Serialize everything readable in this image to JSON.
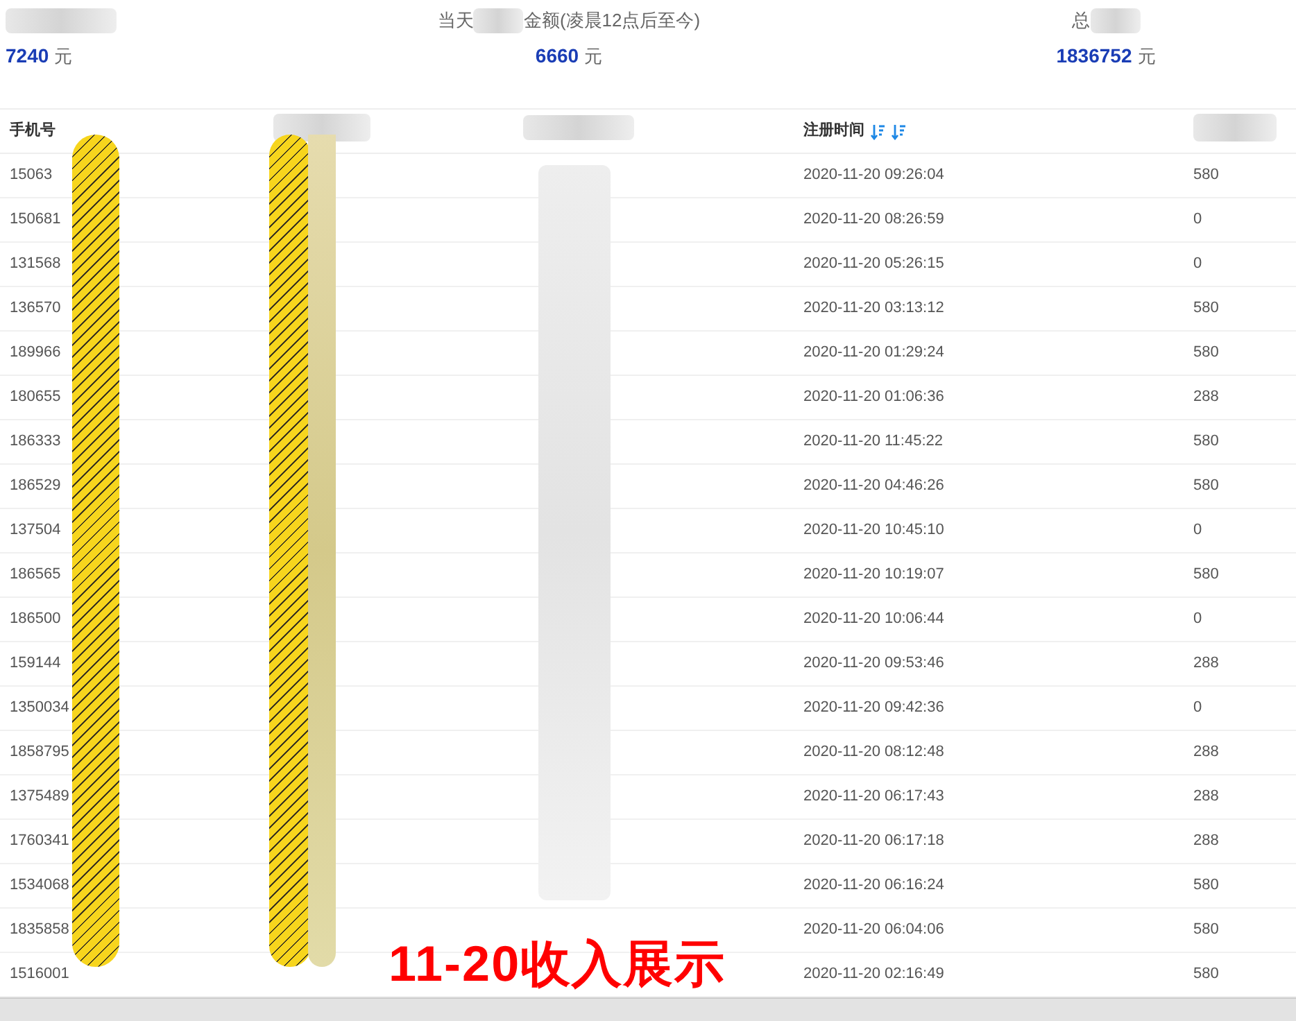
{
  "stats": [
    {
      "value": "7240",
      "unit": "元"
    },
    {
      "label_before_blur": "当天",
      "label_after_blur": "金额(凌晨12点后至今)",
      "value": "6660",
      "unit": "元"
    },
    {
      "label_before_blur": "总",
      "value": "1836752",
      "unit": "元"
    }
  ],
  "table": {
    "header": {
      "phone": "手机号",
      "registered": "注册时间"
    },
    "rows": [
      {
        "phone": "15063",
        "time": "2020-11-20 09:26:04",
        "amount": "580"
      },
      {
        "phone": "150681",
        "time": "2020-11-20 08:26:59",
        "amount": "0"
      },
      {
        "phone": "131568",
        "time": "2020-11-20 05:26:15",
        "amount": "0"
      },
      {
        "phone": "136570",
        "time": "2020-11-20 03:13:12",
        "amount": "580"
      },
      {
        "phone": "189966",
        "time": "2020-11-20 01:29:24",
        "amount": "580"
      },
      {
        "phone": "180655",
        "time": "2020-11-20 01:06:36",
        "amount": "288"
      },
      {
        "phone": "186333",
        "time": "2020-11-20 11:45:22",
        "amount": "580"
      },
      {
        "phone": "186529",
        "time": "2020-11-20 04:46:26",
        "amount": "580"
      },
      {
        "phone": "137504",
        "time": "2020-11-20 10:45:10",
        "amount": "0"
      },
      {
        "phone": "186565",
        "time": "2020-11-20 10:19:07",
        "amount": "580"
      },
      {
        "phone": "186500",
        "time": "2020-11-20 10:06:44",
        "amount": "0"
      },
      {
        "phone": "159144",
        "time": "2020-11-20 09:53:46",
        "amount": "288"
      },
      {
        "phone": "1350034",
        "time": "2020-11-20 09:42:36",
        "amount": "0"
      },
      {
        "phone": "1858795",
        "time": "2020-11-20 08:12:48",
        "amount": "288"
      },
      {
        "phone": "1375489",
        "time": "2020-11-20 06:17:43",
        "amount": "288"
      },
      {
        "phone": "1760341",
        "time": "2020-11-20 06:17:18",
        "amount": "288"
      },
      {
        "phone": "1534068",
        "time": "2020-11-20 06:16:24",
        "amount": "580"
      },
      {
        "phone": "1835858",
        "time": "2020-11-20 06:04:06",
        "amount": "580"
      },
      {
        "phone": "1516001",
        "time": "2020-11-20 02:16:49",
        "amount": "580"
      }
    ]
  },
  "overlay_caption": "11-20收入展示"
}
